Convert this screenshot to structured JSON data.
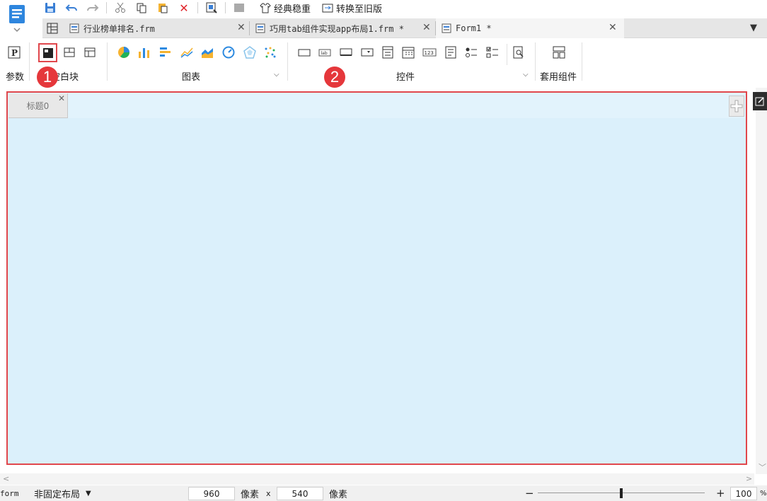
{
  "quick_toolbar": {
    "classic_label": "经典稳重",
    "convert_label": "转换至旧版"
  },
  "tabs": [
    {
      "label": "行业榜单排名.frm"
    },
    {
      "label": "巧用tab组件实现app布局1.frm *"
    },
    {
      "label": "Form1 *"
    }
  ],
  "ribbon": {
    "param_label": "参数",
    "blank_block_label": "空白块",
    "chart_label": "图表",
    "control_label": "控件",
    "template_label": "套用组件"
  },
  "canvas": {
    "tab_title": "标题0"
  },
  "status": {
    "mode": "form",
    "layout": "非固定布局",
    "width": "960",
    "width_unit": "像素",
    "times": "x",
    "height": "540",
    "height_unit": "像素",
    "zoom": "100",
    "zoom_unit": "%",
    "zoom_level": 1.0
  },
  "badges": [
    "1",
    "2"
  ],
  "colors": {
    "accent_red": "#e5373b",
    "canvas_bg": "#dbf0fb",
    "selection_border": "#e0474c"
  }
}
